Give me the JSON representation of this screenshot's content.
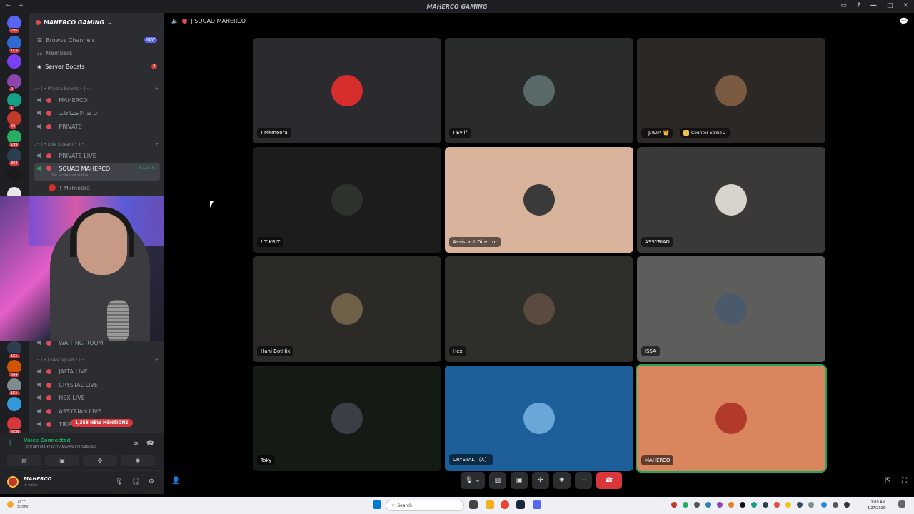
{
  "titlebar": {
    "title": "MAHERCO GAMING"
  },
  "servers": [
    {
      "badge": "296",
      "color": "#5865f2"
    },
    {
      "badge": "1K+",
      "color": "#2f6ad0"
    },
    {
      "badge": "",
      "color": "#7b3ff2"
    },
    {
      "badge": "9",
      "color": "#8e44ad"
    },
    {
      "badge": "1",
      "color": "#16a085"
    },
    {
      "badge": "43",
      "color": "#c0392b"
    },
    {
      "badge": "199",
      "color": "#27ae60"
    },
    {
      "badge": "304",
      "color": "#2c3e50"
    },
    {
      "badge": "",
      "color": "#1a1a1a"
    },
    {
      "badge": "",
      "color": "#e8e8e8"
    }
  ],
  "servers_lower": [
    {
      "badge": "1K+",
      "color": "#2c3e50"
    },
    {
      "badge": "564",
      "color": "#d35400"
    },
    {
      "badge": "1K+",
      "color": "#7f8c8d"
    },
    {
      "badge": "",
      "color": "#3498db"
    },
    {
      "badge": "NEW",
      "color": "#da373c"
    }
  ],
  "sidebar": {
    "server_name": "MAHERCO GAMING",
    "browse": "Browse Channels",
    "browse_badge": "NEW",
    "members": "Members",
    "boosts": "Server Boosts",
    "boosts_count": "8",
    "cat_private": "ـ ─ ( • Private Rooms • ) ─ ـ",
    "ch_maherco": "| MAHERCO",
    "ch_meeting": "| غرفة الاجتماعات",
    "ch_private": "| PRIVATE",
    "cat_live": "ـ ─ ( • Live Stream • ) ─ ـ",
    "ch_private_live": "| PRIVATE LIVE",
    "ch_squad": "| SQUAD MAHERCO",
    "ch_squad_timer": "6:23:07",
    "ch_squad_status": "Set a channel status",
    "ch_squad_member": "! Mkmoora",
    "ch_waiting": "| WAITING ROOM",
    "cat_squad": "ـ ─ ( • Lives Squad • ) ─ ـ",
    "ch_jalta": "| JALTA LIVE",
    "ch_crystal": "| CRYSTAL LIVE",
    "ch_hex": "| HEX LIVE",
    "ch_assyrian": "| ASSYRIAN LIVE",
    "ch_tikrit": "| TIKR",
    "mentions": "1,358 NEW MENTIONS"
  },
  "voice": {
    "status": "Voice Connected",
    "channel": "| SQUAD MAHERCO / MAHERCO GAMING"
  },
  "user": {
    "name": "MAHERCO",
    "status": "In voice"
  },
  "channel_header": {
    "name": "| SQUAD MAHERCO"
  },
  "tiles": [
    {
      "name": "! Mkmoora",
      "bg": "#2b2a2e",
      "avatar": "#d62d2d",
      "game": ""
    },
    {
      "name": "! Evil°",
      "bg": "#2a2c2b",
      "avatar": "#5a6a6a",
      "game": ""
    },
    {
      "name": "! JALTA 👑",
      "bg": "#2b2826",
      "avatar": "#7a5a40",
      "game": "Counter-Strike 2"
    },
    {
      "name": "! TIKRIT",
      "bg": "#1c1d1b",
      "avatar": "#2e322c",
      "game": ""
    },
    {
      "name": "Assistant Director",
      "bg": "#d9b39c",
      "avatar": "#3a3a3a",
      "game": ""
    },
    {
      "name": "ASSYRIAN",
      "bg": "#3a3937",
      "avatar": "#d8d4cc",
      "game": ""
    },
    {
      "name": "Hani BotHix",
      "bg": "#2c2a26",
      "avatar": "#6f604a",
      "game": ""
    },
    {
      "name": "Hex",
      "bg": "#2e2f2b",
      "avatar": "#5a4a40",
      "game": ""
    },
    {
      "name": "ISSA",
      "bg": "#5d5d5b",
      "avatar": "#4a5a6a",
      "game": ""
    },
    {
      "name": "Toky",
      "bg": "#141a14",
      "avatar": "#3a3f45",
      "game": ""
    },
    {
      "name": "CRYSTAL 〔X〕",
      "bg": "#1c5f9a",
      "avatar": "#6aa6d8",
      "game": ""
    },
    {
      "name": "MAHERCO",
      "bg": "#d9865f",
      "avatar": "#b23a2a",
      "game": ""
    }
  ],
  "taskbar": {
    "temp": "75°F",
    "weather": "Sunny",
    "search": "Search",
    "time": "2:09 AM",
    "date": "8/27/2026"
  }
}
